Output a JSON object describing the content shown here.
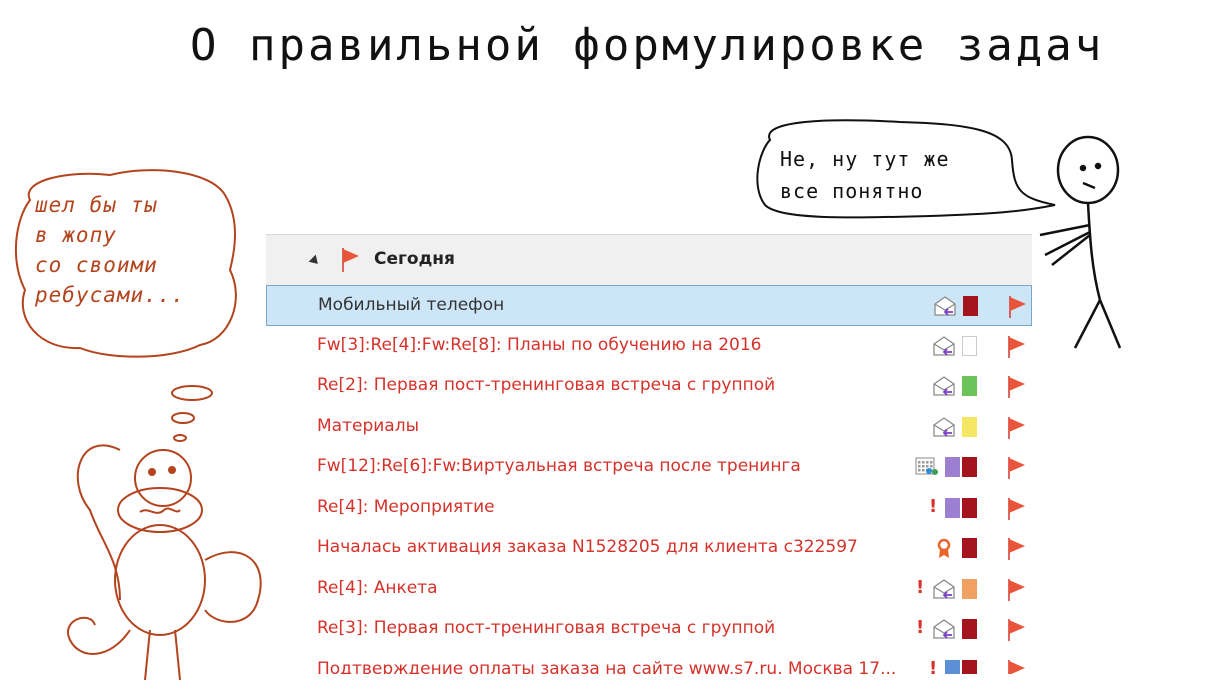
{
  "comic": {
    "title": "О правильной формулировке задач",
    "speech": "Не, ну тут же\nвсе понятно",
    "thought": "шел бы ты\nв жопу\nсо своими\nребусами..."
  },
  "colors": {
    "accent_red": "#d6322a",
    "selected_bg": "#cde6f7",
    "header_bg": "#f0f0f0",
    "thought_ink": "#b3441e"
  },
  "mail": {
    "group_label": "Сегодня",
    "rows": [
      {
        "subject": "Мобильный телефон",
        "selected": true,
        "icon": "envelope-reply-icon",
        "importance": false,
        "categories": [
          "#a3141d"
        ]
      },
      {
        "subject": "Fw[3]:Re[4]:Fw:Re[8]: Планы по обучению на 2016",
        "icon": "envelope-reply-icon",
        "importance": false,
        "categories": [
          "#ffffff"
        ]
      },
      {
        "subject": "Re[2]: Первая пост-тренинговая встреча с группой",
        "icon": "envelope-reply-icon",
        "importance": false,
        "categories": [
          "#6cc35a"
        ]
      },
      {
        "subject": "Материалы",
        "icon": "envelope-reply-icon",
        "importance": false,
        "categories": [
          "#f5e663"
        ]
      },
      {
        "subject": "Fw[12]:Re[6]:Fw:Виртуальная встреча после тренинга",
        "icon": "meeting-icon",
        "importance": false,
        "categories": [
          "#9c7fd1",
          "#a3141d"
        ]
      },
      {
        "subject": "Re[4]: Мероприятие",
        "icon": "",
        "importance": true,
        "categories": [
          "#9c7fd1",
          "#a3141d"
        ]
      },
      {
        "subject": "Началась активация заказа N1528205 для клиента c322597",
        "icon": "ribbon-icon",
        "importance": false,
        "categories": [
          "#a3141d"
        ]
      },
      {
        "subject": "Re[4]: Анкета",
        "icon": "envelope-reply-icon",
        "importance": true,
        "categories": [
          "#f0a060"
        ]
      },
      {
        "subject": "Re[3]: Первая пост-тренинговая встреча с группой",
        "icon": "envelope-reply-icon",
        "importance": true,
        "categories": [
          "#a3141d"
        ]
      },
      {
        "subject": "Подтверждение оплаты заказа на сайте www.s7.ru, Москва 17...",
        "icon": "",
        "importance": true,
        "categories": [
          "#5b8fd6",
          "#a3141d"
        ]
      }
    ]
  }
}
